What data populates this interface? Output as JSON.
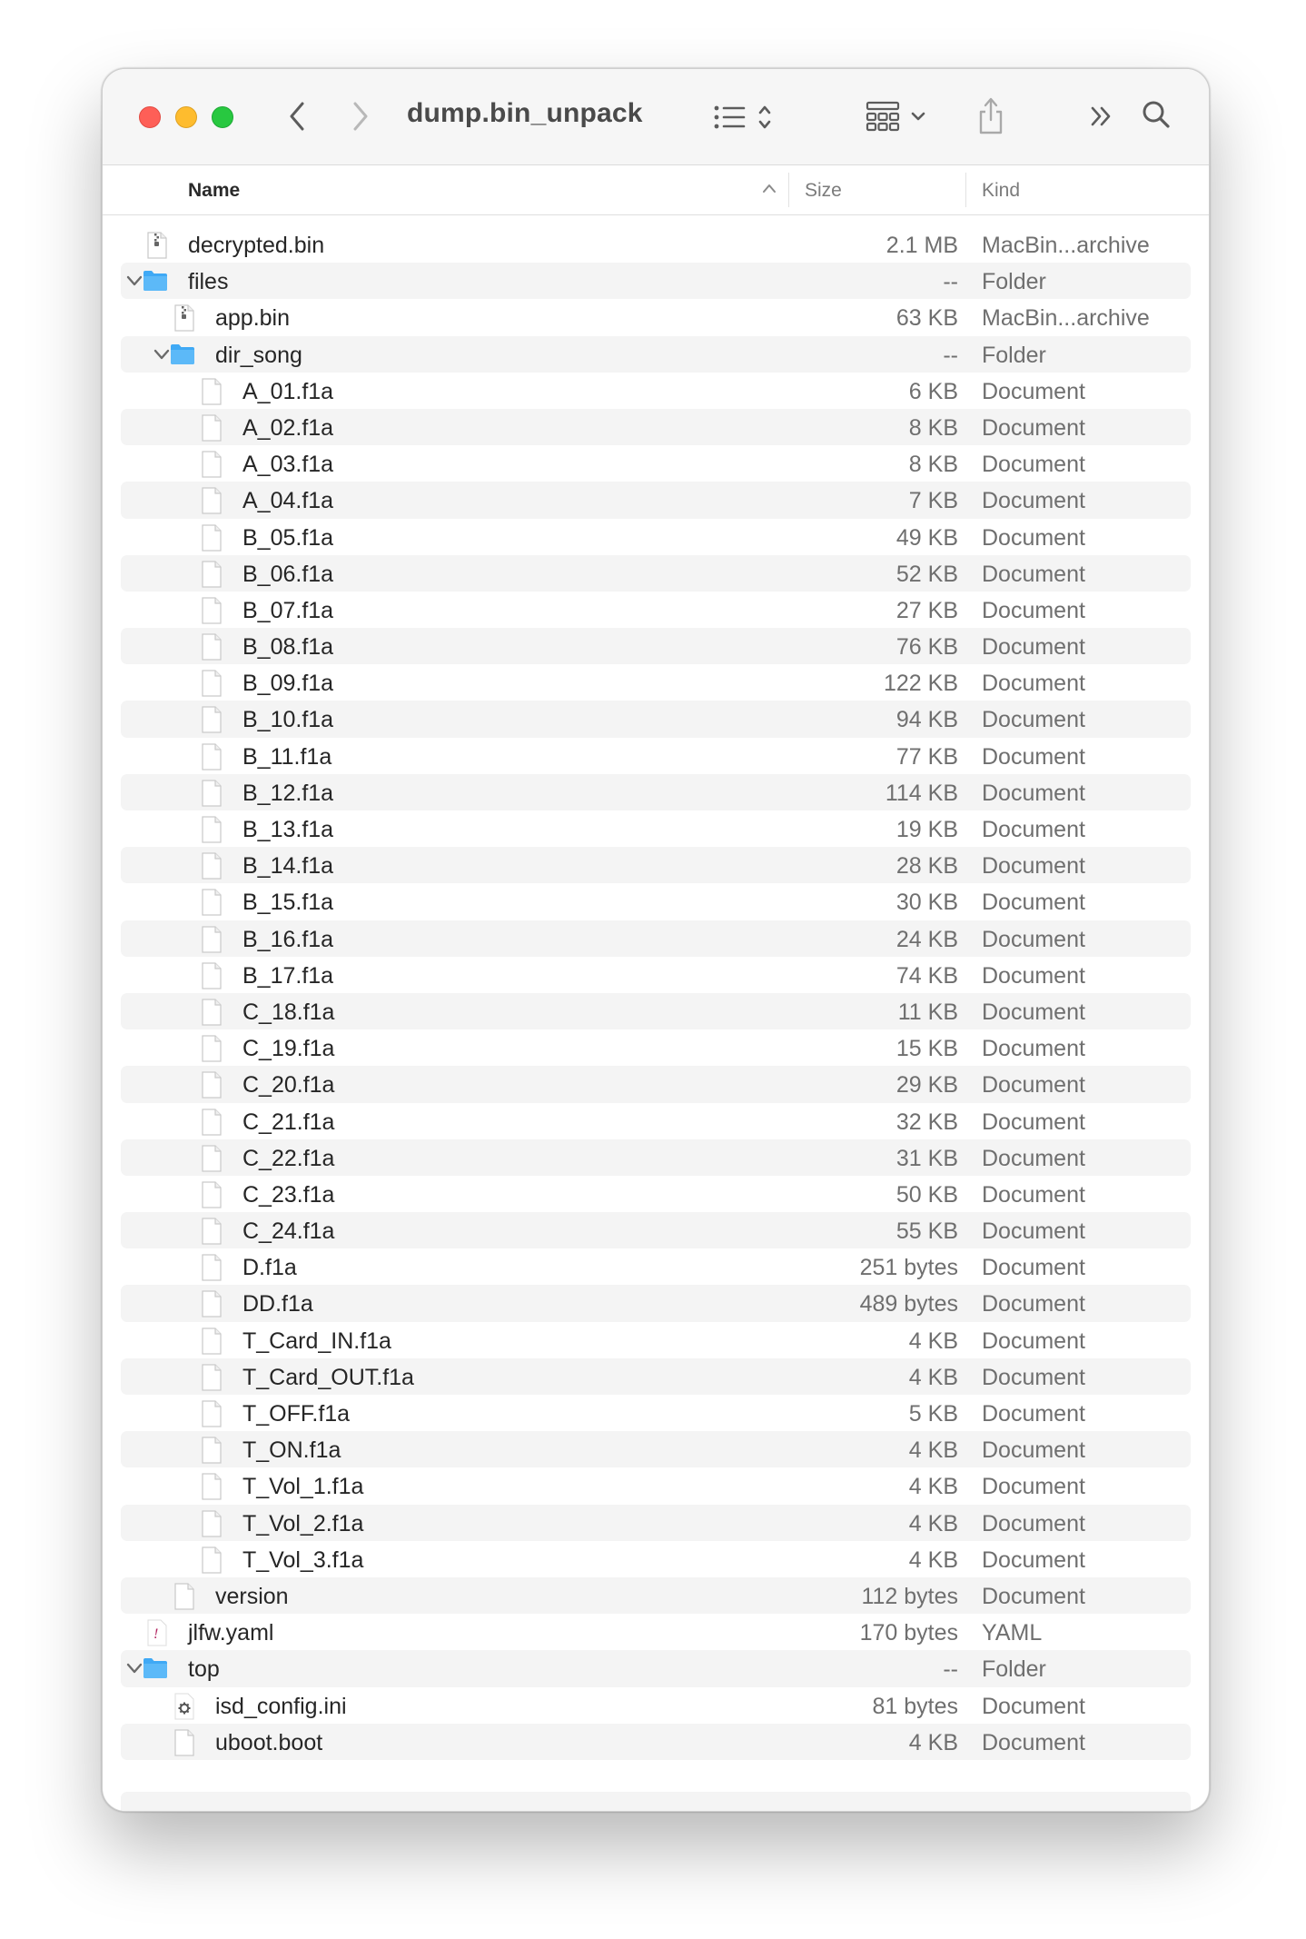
{
  "window": {
    "title": "dump.bin_unpack"
  },
  "toolbar": {
    "back_icon": "chevron-left-icon",
    "forward_icon": "chevron-right-icon",
    "view_icon": "list-view-icon",
    "group_icon": "grid-group-icon",
    "share_icon": "share-icon",
    "more_icon": "double-chevron-right-icon",
    "search_icon": "search-icon"
  },
  "columns": {
    "name": "Name",
    "size": "Size",
    "kind": "Kind"
  },
  "colors": {
    "close": "#fe5f57",
    "minimize": "#febc2e",
    "zoom": "#28c840",
    "folder": "#3fa9f5"
  },
  "rows": [
    {
      "name": "decrypted.bin",
      "size": "2.1 MB",
      "kind": "MacBin...archive",
      "level": 0,
      "type": "archive",
      "expanded": null
    },
    {
      "name": "files",
      "size": "--",
      "kind": "Folder",
      "level": 0,
      "type": "folder",
      "expanded": true
    },
    {
      "name": "app.bin",
      "size": "63 KB",
      "kind": "MacBin...archive",
      "level": 1,
      "type": "archive",
      "expanded": null
    },
    {
      "name": "dir_song",
      "size": "--",
      "kind": "Folder",
      "level": 1,
      "type": "folder",
      "expanded": true
    },
    {
      "name": "A_01.f1a",
      "size": "6 KB",
      "kind": "Document",
      "level": 2,
      "type": "doc",
      "expanded": null
    },
    {
      "name": "A_02.f1a",
      "size": "8 KB",
      "kind": "Document",
      "level": 2,
      "type": "doc",
      "expanded": null
    },
    {
      "name": "A_03.f1a",
      "size": "8 KB",
      "kind": "Document",
      "level": 2,
      "type": "doc",
      "expanded": null
    },
    {
      "name": "A_04.f1a",
      "size": "7 KB",
      "kind": "Document",
      "level": 2,
      "type": "doc",
      "expanded": null
    },
    {
      "name": "B_05.f1a",
      "size": "49 KB",
      "kind": "Document",
      "level": 2,
      "type": "doc",
      "expanded": null
    },
    {
      "name": "B_06.f1a",
      "size": "52 KB",
      "kind": "Document",
      "level": 2,
      "type": "doc",
      "expanded": null
    },
    {
      "name": "B_07.f1a",
      "size": "27 KB",
      "kind": "Document",
      "level": 2,
      "type": "doc",
      "expanded": null
    },
    {
      "name": "B_08.f1a",
      "size": "76 KB",
      "kind": "Document",
      "level": 2,
      "type": "doc",
      "expanded": null
    },
    {
      "name": "B_09.f1a",
      "size": "122 KB",
      "kind": "Document",
      "level": 2,
      "type": "doc",
      "expanded": null
    },
    {
      "name": "B_10.f1a",
      "size": "94 KB",
      "kind": "Document",
      "level": 2,
      "type": "doc",
      "expanded": null
    },
    {
      "name": "B_11.f1a",
      "size": "77 KB",
      "kind": "Document",
      "level": 2,
      "type": "doc",
      "expanded": null
    },
    {
      "name": "B_12.f1a",
      "size": "114 KB",
      "kind": "Document",
      "level": 2,
      "type": "doc",
      "expanded": null
    },
    {
      "name": "B_13.f1a",
      "size": "19 KB",
      "kind": "Document",
      "level": 2,
      "type": "doc",
      "expanded": null
    },
    {
      "name": "B_14.f1a",
      "size": "28 KB",
      "kind": "Document",
      "level": 2,
      "type": "doc",
      "expanded": null
    },
    {
      "name": "B_15.f1a",
      "size": "30 KB",
      "kind": "Document",
      "level": 2,
      "type": "doc",
      "expanded": null
    },
    {
      "name": "B_16.f1a",
      "size": "24 KB",
      "kind": "Document",
      "level": 2,
      "type": "doc",
      "expanded": null
    },
    {
      "name": "B_17.f1a",
      "size": "74 KB",
      "kind": "Document",
      "level": 2,
      "type": "doc",
      "expanded": null
    },
    {
      "name": "C_18.f1a",
      "size": "11 KB",
      "kind": "Document",
      "level": 2,
      "type": "doc",
      "expanded": null
    },
    {
      "name": "C_19.f1a",
      "size": "15 KB",
      "kind": "Document",
      "level": 2,
      "type": "doc",
      "expanded": null
    },
    {
      "name": "C_20.f1a",
      "size": "29 KB",
      "kind": "Document",
      "level": 2,
      "type": "doc",
      "expanded": null
    },
    {
      "name": "C_21.f1a",
      "size": "32 KB",
      "kind": "Document",
      "level": 2,
      "type": "doc",
      "expanded": null
    },
    {
      "name": "C_22.f1a",
      "size": "31 KB",
      "kind": "Document",
      "level": 2,
      "type": "doc",
      "expanded": null
    },
    {
      "name": "C_23.f1a",
      "size": "50 KB",
      "kind": "Document",
      "level": 2,
      "type": "doc",
      "expanded": null
    },
    {
      "name": "C_24.f1a",
      "size": "55 KB",
      "kind": "Document",
      "level": 2,
      "type": "doc",
      "expanded": null
    },
    {
      "name": "D.f1a",
      "size": "251 bytes",
      "kind": "Document",
      "level": 2,
      "type": "doc",
      "expanded": null
    },
    {
      "name": "DD.f1a",
      "size": "489 bytes",
      "kind": "Document",
      "level": 2,
      "type": "doc",
      "expanded": null
    },
    {
      "name": "T_Card_IN.f1a",
      "size": "4 KB",
      "kind": "Document",
      "level": 2,
      "type": "doc",
      "expanded": null
    },
    {
      "name": "T_Card_OUT.f1a",
      "size": "4 KB",
      "kind": "Document",
      "level": 2,
      "type": "doc",
      "expanded": null
    },
    {
      "name": "T_OFF.f1a",
      "size": "5 KB",
      "kind": "Document",
      "level": 2,
      "type": "doc",
      "expanded": null
    },
    {
      "name": "T_ON.f1a",
      "size": "4 KB",
      "kind": "Document",
      "level": 2,
      "type": "doc",
      "expanded": null
    },
    {
      "name": "T_Vol_1.f1a",
      "size": "4 KB",
      "kind": "Document",
      "level": 2,
      "type": "doc",
      "expanded": null
    },
    {
      "name": "T_Vol_2.f1a",
      "size": "4 KB",
      "kind": "Document",
      "level": 2,
      "type": "doc",
      "expanded": null
    },
    {
      "name": "T_Vol_3.f1a",
      "size": "4 KB",
      "kind": "Document",
      "level": 2,
      "type": "doc",
      "expanded": null
    },
    {
      "name": "version",
      "size": "112 bytes",
      "kind": "Document",
      "level": 1,
      "type": "doc",
      "expanded": null
    },
    {
      "name": "jlfw.yaml",
      "size": "170 bytes",
      "kind": "YAML",
      "level": 0,
      "type": "yaml",
      "expanded": null
    },
    {
      "name": "top",
      "size": "--",
      "kind": "Folder",
      "level": 0,
      "type": "folder",
      "expanded": true
    },
    {
      "name": "isd_config.ini",
      "size": "81 bytes",
      "kind": "Document",
      "level": 1,
      "type": "ini",
      "expanded": null
    },
    {
      "name": "uboot.boot",
      "size": "4 KB",
      "kind": "Document",
      "level": 1,
      "type": "doc",
      "expanded": null
    }
  ]
}
